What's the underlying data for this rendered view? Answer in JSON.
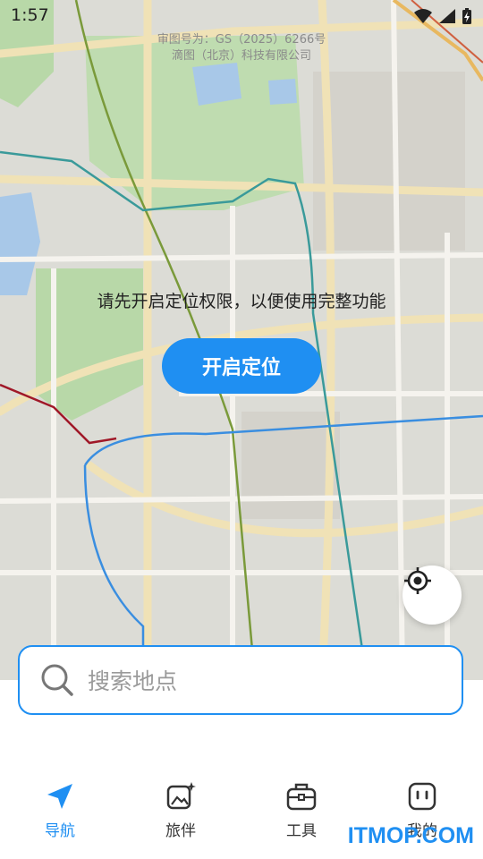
{
  "status_bar": {
    "time": "1:57"
  },
  "map": {
    "approval_line1": "审图号为：GS（2025）6266号",
    "approval_line2": "滴图（北京）科技有限公司",
    "permission_prompt": "请先开启定位权限，以便使用完整功能",
    "enable_location_label": "开启定位"
  },
  "search": {
    "placeholder": "搜索地点"
  },
  "tabs": [
    {
      "label": "导航",
      "icon": "navigation-arrow-icon",
      "active": true
    },
    {
      "label": "旅伴",
      "icon": "photo-sparkle-icon",
      "active": false
    },
    {
      "label": "工具",
      "icon": "toolbox-icon",
      "active": false
    },
    {
      "label": "我的",
      "icon": "face-square-icon",
      "active": false
    }
  ],
  "watermark": "ITMOP.COM",
  "colors": {
    "accent": "#1f8ff2",
    "map_background": "#dcdcd6",
    "park": "#b8d8a8",
    "water": "#a8c8e8"
  }
}
